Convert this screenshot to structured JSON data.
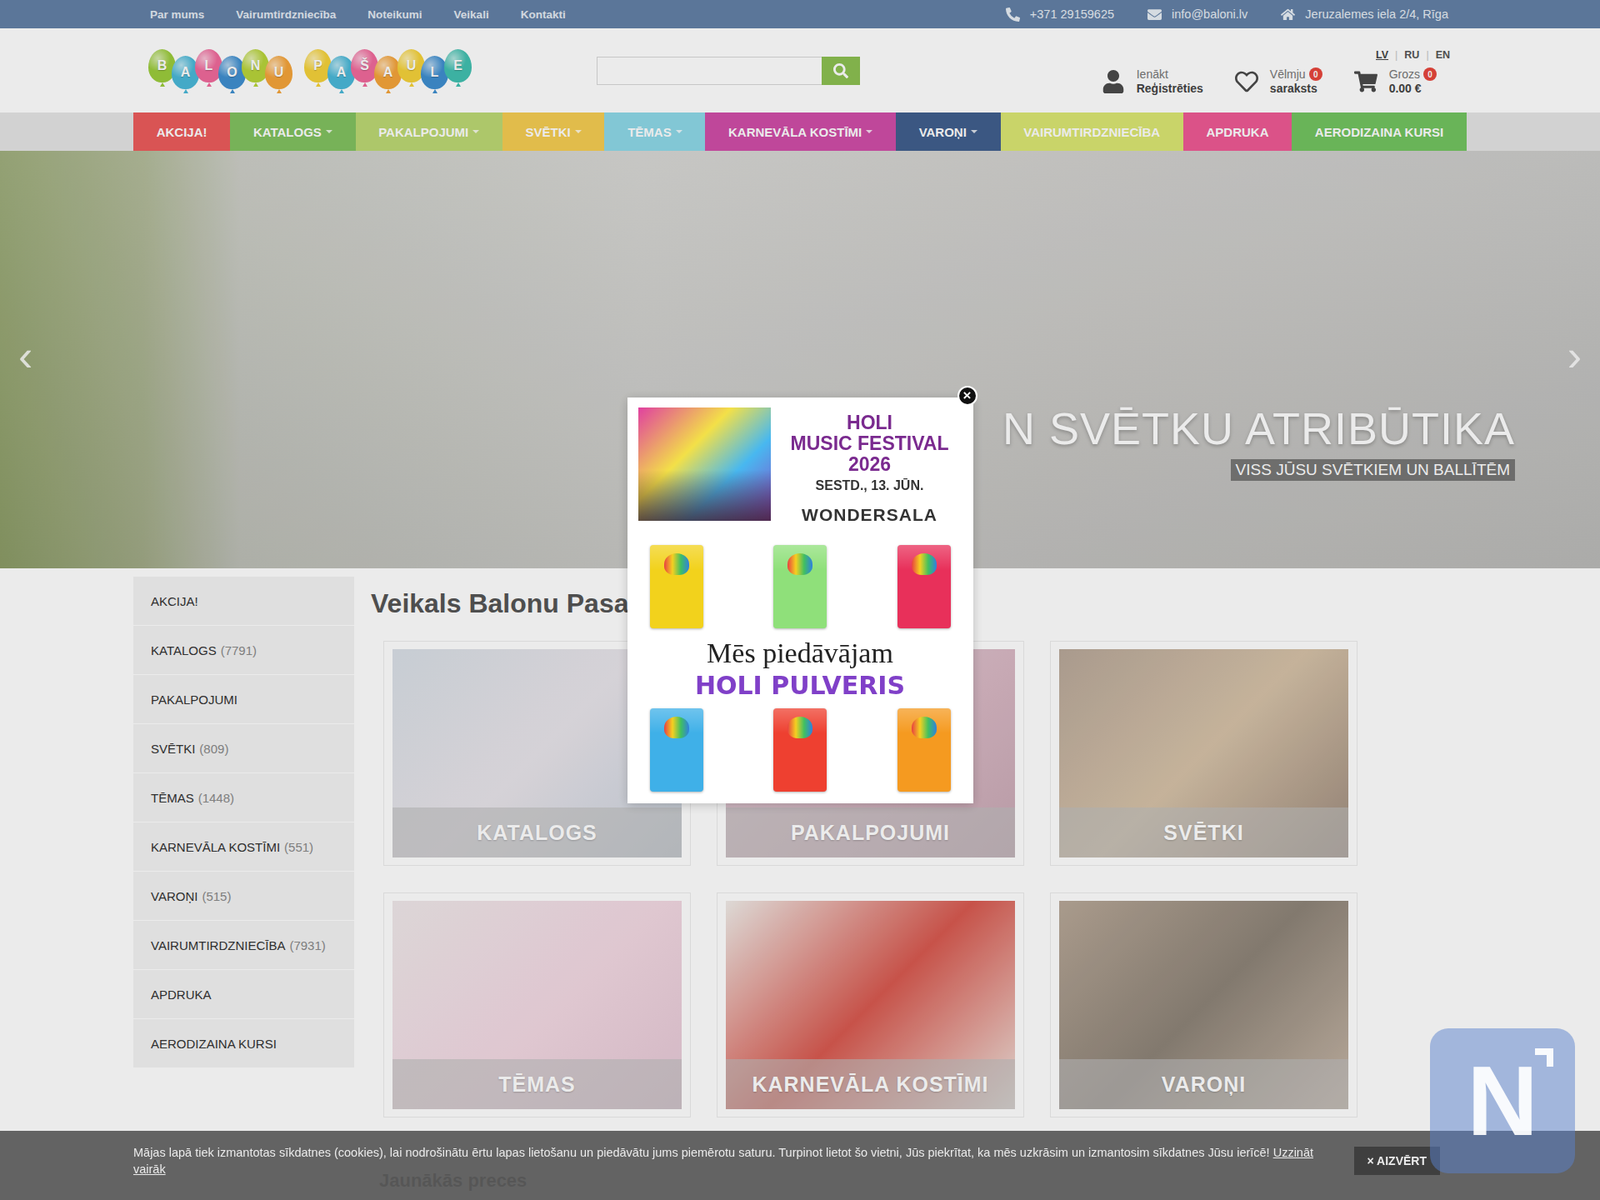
{
  "topbar": {
    "links": [
      "Par mums",
      "Vairumtirdzniecība",
      "Noteikumi",
      "Veikali",
      "Kontakti"
    ],
    "phone": "+371 29159625",
    "email": "info@baloni.lv",
    "address": "Jeruzalemes iela 2/4, Rīga"
  },
  "languages": [
    {
      "label": "LV",
      "selected": true
    },
    {
      "label": "RU",
      "selected": false
    },
    {
      "label": "EN",
      "selected": false
    }
  ],
  "language_separator": "|",
  "logo": {
    "words": [
      [
        {
          "letter": "B",
          "color": "#9ccc3c"
        },
        {
          "letter": "A",
          "color": "#4ab8d8"
        },
        {
          "letter": "L",
          "color": "#f06a9c"
        },
        {
          "letter": "O",
          "color": "#3f8fd0"
        },
        {
          "letter": "N",
          "color": "#b8d43a"
        },
        {
          "letter": "U",
          "color": "#f5a43a"
        }
      ],
      [
        {
          "letter": "P",
          "color": "#f5d23a"
        },
        {
          "letter": "A",
          "color": "#4ab8d8"
        },
        {
          "letter": "Š",
          "color": "#f06a9c"
        },
        {
          "letter": "A",
          "color": "#f5a43a"
        },
        {
          "letter": "U",
          "color": "#f5d23a"
        },
        {
          "letter": "L",
          "color": "#3f8fd0"
        },
        {
          "letter": "E",
          "color": "#42c0b0"
        }
      ]
    ]
  },
  "search": {
    "placeholder": ""
  },
  "account": {
    "line1": "Ienākt",
    "line2": "Reģistrēties"
  },
  "wishlist": {
    "line1": "Vēlmju",
    "line2": "saraksts",
    "badge": "0"
  },
  "cart": {
    "line1": "Grozs",
    "line2": "0.00 €",
    "badge": "0"
  },
  "nav": [
    {
      "label": "AKCIJA!",
      "dropdown": false,
      "color": "#ec5c5c"
    },
    {
      "label": "KATALOGS",
      "dropdown": true,
      "color": "#82c260"
    },
    {
      "label": "PAKALPOJUMI",
      "dropdown": true,
      "color": "#bcd874"
    },
    {
      "label": "SVĒTKI",
      "dropdown": true,
      "color": "#f5cc52"
    },
    {
      "label": "TĒMAS",
      "dropdown": true,
      "color": "#8ed8e8"
    },
    {
      "label": "KARNEVĀLA KOSTĪMI",
      "dropdown": true,
      "color": "#d04ea8"
    },
    {
      "label": "VAROŅI",
      "dropdown": true,
      "color": "#415f8e"
    },
    {
      "label": "VAIRUMTIRDZNIECĪBA",
      "dropdown": false,
      "color": "#dbe672"
    },
    {
      "label": "APDRUKA",
      "dropdown": false,
      "color": "#ee5a94"
    },
    {
      "label": "AERODIZAINA KURSI",
      "dropdown": false,
      "color": "#72c460"
    }
  ],
  "hero": {
    "title": "N SVĒTKU ATRIBŪTIKA",
    "subtitle": "VISS JŪSU SVĒTKIEM UN BALLĪTĒM",
    "prev": "‹",
    "next": "›"
  },
  "sidebar": [
    {
      "label": "AKCIJA!"
    },
    {
      "label": "KATALOGS",
      "count": "(7791)"
    },
    {
      "label": "PAKALPOJUMI"
    },
    {
      "label": "SVĒTKI",
      "count": "(809)"
    },
    {
      "label": "TĒMAS",
      "count": "(1448)"
    },
    {
      "label": "KARNEVĀLA KOSTĪMI",
      "count": "(551)"
    },
    {
      "label": "VAROŅI",
      "count": "(515)"
    },
    {
      "label": "VAIRUMTIRDZNIECĪBA",
      "count": "(7931)"
    },
    {
      "label": "APDRUKA"
    },
    {
      "label": "AERODIZAINA KURSI"
    }
  ],
  "main": {
    "title": "Veikals Balonu Pasa",
    "section": "Jaunākās preces"
  },
  "cards": [
    "KATALOGS",
    "PAKALPOJUMI",
    "SVĒTKI",
    "TĒMAS",
    "KARNEVĀLA KOSTĪMI",
    "VAROŅI"
  ],
  "popup": {
    "close": "×",
    "lines": [
      "HOLI",
      "MUSIC FESTIVAL",
      "2026"
    ],
    "date": "SESTD., 13. JŪN.",
    "place": "WONDERSALA",
    "offer": "Mēs piedāvājam",
    "product": "HOLI PULVERIS",
    "packets_top": [
      {
        "color": "#f2d21c"
      },
      {
        "color": "#8fe07a"
      },
      {
        "color": "#e8305a"
      }
    ],
    "packets_bottom": [
      {
        "color": "#3fb0e8"
      },
      {
        "color": "#ee4030"
      },
      {
        "color": "#f59a20"
      }
    ]
  },
  "cookie": {
    "text": "Mājas lapā tiek izmantotas sīkdatnes (cookies), lai nodrošinātu ērtu lapas lietošanu un piedāvātu jums piemērotu saturu. Turpinot lietot šo vietni, Jūs piekrītat, ka mēs uzkrāsim un izmantosim sīkdatnes Jūsu ierīcē!",
    "link": "Uzzināt vairāk",
    "button": "× AIZVĒRT"
  },
  "widget": {
    "label": "N"
  }
}
